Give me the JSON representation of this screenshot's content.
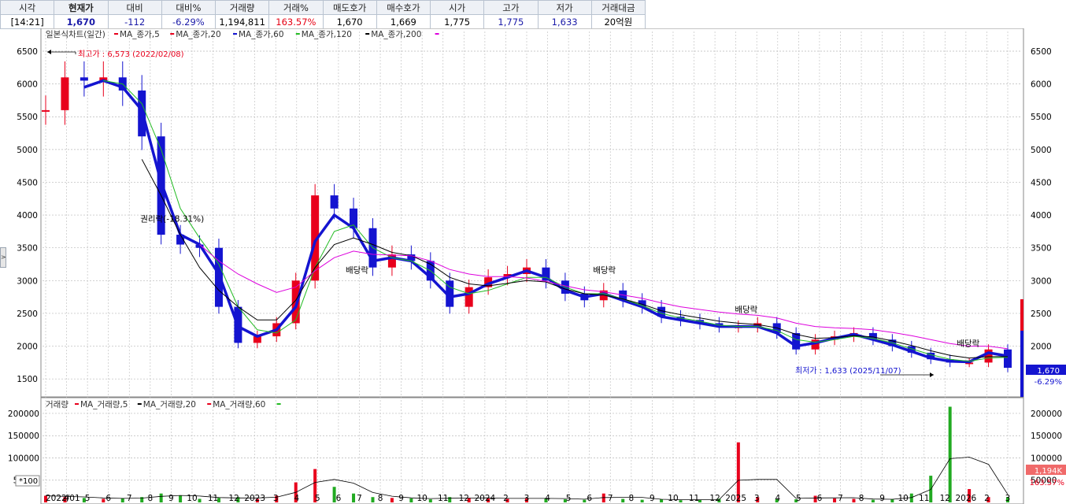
{
  "quote": {
    "headers": [
      "시각",
      "현재가",
      "대비",
      "대비%",
      "거래량",
      "거래%",
      "매도호가",
      "매수호가",
      "시가",
      "고가",
      "저가",
      "거래대금"
    ],
    "time": "[14:21]",
    "price": "1,670",
    "change": "-112",
    "change_pct": "-6.29%",
    "volume": "1,194,811",
    "volume_pct": "163.57%",
    "ask": "1,670",
    "bid": "1,669",
    "open": "1,775",
    "high": "1,775",
    "low": "1,633",
    "turnover": "20억원"
  },
  "side_tab": ">",
  "price_panel": {
    "legend_title": "일본식차트(일간)",
    "ma_legend": [
      {
        "label": "MA_종가,5",
        "color": "#e8001c"
      },
      {
        "label": "MA_종가,20",
        "color": "#e8001c"
      },
      {
        "label": "MA_종가,60",
        "color": "#1414d0"
      },
      {
        "label": "MA_종가,120",
        "color": "#22bb22"
      },
      {
        "label": "MA_종가,200",
        "color": "#000000"
      }
    ],
    "ma_legend_end_color": "#dd00dd",
    "y_ticks": [
      "6500",
      "6000",
      "5500",
      "5000",
      "4500",
      "4000",
      "3500",
      "3000",
      "2500",
      "2000",
      "1500"
    ],
    "high_label": "최고가 : 6,573 (2022/02/08)",
    "low_label": "최저가 : 1,633 (2025/11/07)",
    "annotations": [
      {
        "text": "권리락(-18.31%)",
        "x_frac": 0.1,
        "y": 3900
      },
      {
        "text": "배당락",
        "x_frac": 0.31,
        "y": 3120
      },
      {
        "text": "배당락",
        "x_frac": 0.563,
        "y": 3120
      },
      {
        "text": "배당락",
        "x_frac": 0.708,
        "y": 2520
      },
      {
        "text": "배당락",
        "x_frac": 0.935,
        "y": 2000
      }
    ],
    "current_price_box": "1,670",
    "current_pct_box": "-6.29%"
  },
  "volume_panel": {
    "legend_title": "거래량",
    "ma_legend": [
      {
        "label": "MA_거래량,5",
        "color": "#e8001c"
      },
      {
        "label": "MA_거래량,20",
        "color": "#000000"
      },
      {
        "label": "MA_거래량,60",
        "color": "#e8001c"
      }
    ],
    "ma_legend_end_color": "#22bb22",
    "y_ticks": [
      "200000",
      "150000",
      "100000",
      "50000"
    ],
    "unit_label": "*100",
    "current_volume_box": "1,194K",
    "current_volume_pct_box": "163.57%"
  },
  "x_axis": {
    "ticks": [
      "2022/01",
      "4",
      "5",
      "6",
      "7",
      "8",
      "9",
      "10",
      "11",
      "12",
      "2023",
      "3",
      "4",
      "5",
      "6",
      "7",
      "8",
      "9",
      "10",
      "11",
      "12",
      "2024",
      "2",
      "3",
      "4",
      "5",
      "6",
      "7",
      "8",
      "9",
      "10",
      "11",
      "12",
      "2025",
      "3",
      "4",
      "5",
      "6",
      "7",
      "8",
      "9",
      "10",
      "11",
      "12",
      "2026",
      "2",
      "3"
    ]
  },
  "colors": {
    "up": "#e8001c",
    "down": "#1414d0",
    "ma5": "#e8001c",
    "ma20": "#1414d0",
    "ma60": "#22bb22",
    "ma120": "#000000",
    "ma200": "#dd00dd"
  },
  "chart_data": {
    "type": "line",
    "subtype": "candlestick with moving averages",
    "title": "일본식차트(일간)",
    "price": {
      "x": [
        "2022/01",
        "2022/02",
        "2022/03",
        "2022/04",
        "2022/05",
        "2022/06",
        "2022/07",
        "2022/08",
        "2022/09",
        "2022/10",
        "2022/11",
        "2022/12",
        "2023/01",
        "2023/02",
        "2023/03",
        "2023/04",
        "2023/05",
        "2023/06",
        "2023/07",
        "2023/08",
        "2023/09",
        "2023/10",
        "2023/11",
        "2023/12",
        "2024/01",
        "2024/02",
        "2024/03",
        "2024/04",
        "2024/05",
        "2024/06",
        "2024/07",
        "2024/08",
        "2024/09",
        "2024/10",
        "2024/11",
        "2024/12",
        "2025/01",
        "2025/02",
        "2025/03",
        "2025/04",
        "2025/05",
        "2025/06",
        "2025/07",
        "2025/08",
        "2025/09",
        "2025/10",
        "2025/11",
        "2025/12",
        "2026/01",
        "2026/02",
        "2026/03"
      ],
      "close": [
        5600,
        6100,
        6050,
        6100,
        5900,
        5200,
        3700,
        3550,
        3500,
        2600,
        2050,
        2150,
        2350,
        3000,
        4300,
        4100,
        3800,
        3200,
        3400,
        3300,
        3000,
        2600,
        2900,
        3050,
        3100,
        3200,
        3000,
        2800,
        2700,
        2850,
        2700,
        2600,
        2450,
        2400,
        2350,
        2300,
        2300,
        2350,
        2200,
        1950,
        2100,
        2150,
        2200,
        2100,
        2000,
        1900,
        1800,
        1750,
        1750,
        1950,
        1670
      ],
      "ma_series": [
        {
          "name": "MA_종가,60",
          "values": [
            null,
            null,
            5950,
            6050,
            5950,
            5600,
            4500,
            3700,
            3550,
            3100,
            2300,
            2150,
            2250,
            2600,
            3600,
            4000,
            3800,
            3300,
            3350,
            3300,
            3050,
            2750,
            2800,
            2950,
            3050,
            3150,
            3050,
            2850,
            2750,
            2800,
            2700,
            2600,
            2450,
            2400,
            2350,
            2300,
            2300,
            2300,
            2200,
            2000,
            2050,
            2120,
            2180,
            2100,
            2020,
            1920,
            1820,
            1770,
            1760,
            1900,
            1850
          ]
        },
        {
          "name": "MA_종가,120",
          "values": [
            null,
            null,
            null,
            6050,
            6000,
            5700,
            5000,
            4100,
            3650,
            3250,
            2600,
            2250,
            2200,
            2400,
            3200,
            3750,
            3850,
            3500,
            3350,
            3300,
            3150,
            2900,
            2800,
            2850,
            2950,
            3050,
            3050,
            2900,
            2800,
            2800,
            2720,
            2620,
            2500,
            2430,
            2380,
            2320,
            2300,
            2300,
            2240,
            2100,
            2060,
            2100,
            2150,
            2120,
            2050,
            1960,
            1870,
            1800,
            1770,
            1820,
            1830
          ]
        },
        {
          "name": "MA_종가,200",
          "values": [
            null,
            null,
            null,
            null,
            null,
            4850,
            4300,
            3700,
            3200,
            2850,
            2600,
            2400,
            2400,
            2700,
            3200,
            3550,
            3650,
            3550,
            3430,
            3380,
            3250,
            3050,
            2950,
            2920,
            2960,
            3000,
            2980,
            2870,
            2800,
            2780,
            2720,
            2640,
            2540,
            2480,
            2430,
            2380,
            2350,
            2330,
            2280,
            2180,
            2120,
            2130,
            2160,
            2140,
            2080,
            2010,
            1930,
            1860,
            1820,
            1840,
            1840
          ]
        },
        {
          "name": "MA_종가,5",
          "values": [
            null,
            null,
            null,
            null,
            null,
            null,
            null,
            null,
            3550,
            3300,
            3100,
            2950,
            2820,
            2900,
            3150,
            3350,
            3450,
            3400,
            3390,
            3380,
            3300,
            3170,
            3100,
            3060,
            3060,
            3040,
            2990,
            2920,
            2860,
            2830,
            2780,
            2730,
            2660,
            2600,
            2560,
            2520,
            2490,
            2470,
            2430,
            2350,
            2300,
            2280,
            2270,
            2250,
            2210,
            2160,
            2100,
            2040,
            2000,
            2000,
            1960
          ]
        }
      ],
      "high": {
        "value": 6573,
        "date": "2022/02/08"
      },
      "low": {
        "value": 1633,
        "date": "2025/11/07"
      },
      "ylim": [
        1250,
        6800
      ],
      "y_ticks": [
        1500,
        2000,
        2500,
        3000,
        3500,
        4000,
        4500,
        5000,
        5500,
        6000,
        6500
      ]
    },
    "volume": {
      "x": [
        "2022/01",
        "2022/02",
        "2022/03",
        "2022/04",
        "2022/05",
        "2022/06",
        "2022/07",
        "2022/08",
        "2022/09",
        "2022/10",
        "2022/11",
        "2022/12",
        "2023/01",
        "2023/02",
        "2023/03",
        "2023/04",
        "2023/05",
        "2023/06",
        "2023/07",
        "2023/08",
        "2023/09",
        "2023/10",
        "2023/11",
        "2023/12",
        "2024/01",
        "2024/02",
        "2024/03",
        "2024/04",
        "2024/05",
        "2024/06",
        "2024/07",
        "2024/08",
        "2024/09",
        "2024/10",
        "2024/11",
        "2024/12",
        "2025/01",
        "2025/02",
        "2025/03",
        "2025/04",
        "2025/05",
        "2025/06",
        "2025/07",
        "2025/08",
        "2025/09",
        "2025/10",
        "2025/11",
        "2025/12",
        "2026/01",
        "2026/02",
        "2026/03"
      ],
      "values": [
        15000,
        12000,
        10000,
        8000,
        9000,
        12000,
        20000,
        15000,
        8000,
        10000,
        12000,
        8000,
        15000,
        45000,
        75000,
        35000,
        20000,
        12000,
        10000,
        9000,
        7000,
        12000,
        10000,
        9000,
        8000,
        10000,
        9000,
        7000,
        6000,
        20000,
        8000,
        6000,
        7000,
        5000,
        6000,
        8000,
        135000,
        12000,
        8000,
        7000,
        15000,
        9000,
        8000,
        6000,
        7000,
        20000,
        60000,
        215000,
        30000,
        12000,
        11948
      ],
      "ylim": [
        0,
        230000
      ],
      "y_ticks": [
        50000,
        100000,
        150000,
        200000
      ],
      "current": "1,194K"
    }
  }
}
